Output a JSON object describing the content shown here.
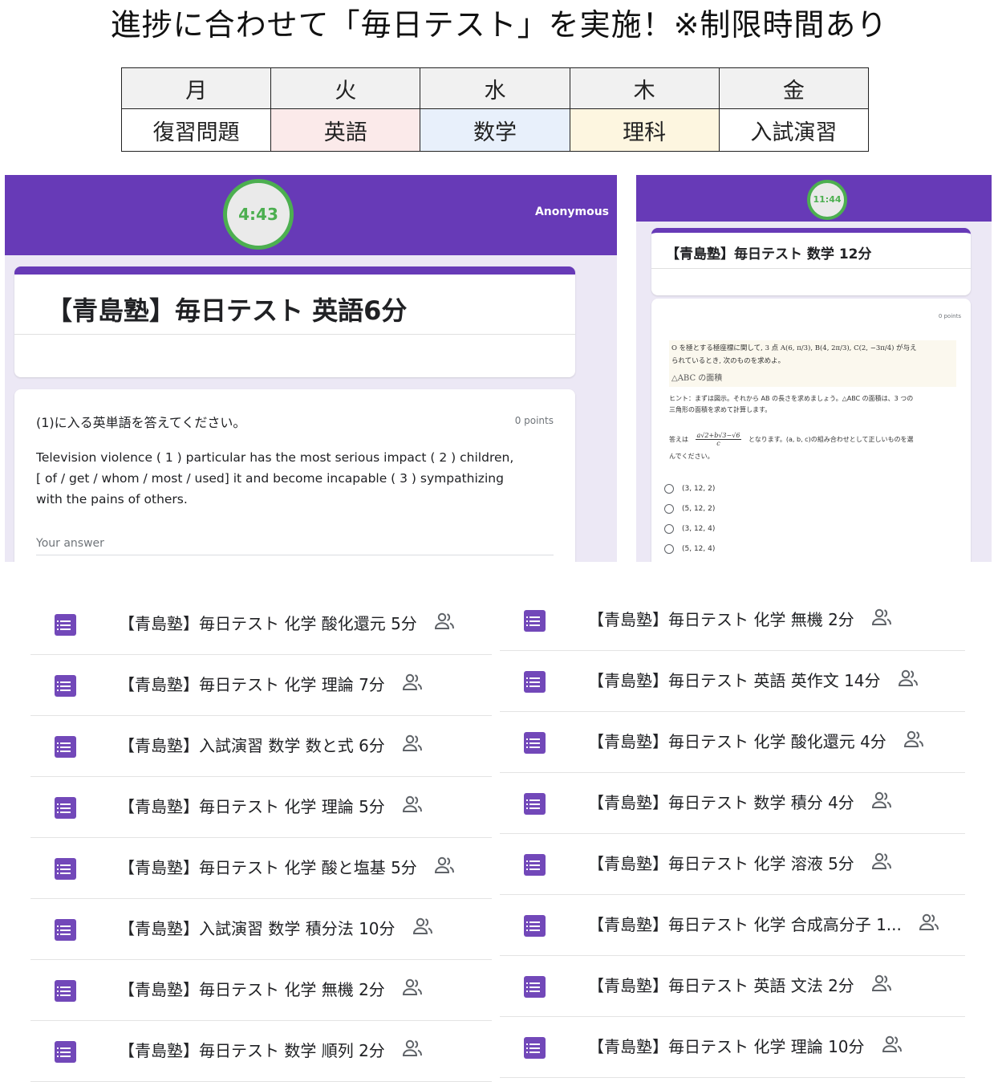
{
  "headline": "進捗に合わせて「毎日テスト」を実施！※制限時間あり",
  "schedule": {
    "days": [
      "月",
      "火",
      "水",
      "木",
      "金"
    ],
    "subjects": [
      "復習問題",
      "英語",
      "数学",
      "理科",
      "入試演習"
    ],
    "cell_colors": [
      "#ffffff",
      "#fbeaea",
      "#e8f0fb",
      "#fdf6e0",
      "#ffffff"
    ]
  },
  "form_english": {
    "timer": "4:43",
    "user": "Anonymous",
    "title": "【青島塾】毎日テスト 英語6分",
    "question": "(1)に入る英単語を答えてください。",
    "points": "0 points",
    "passage_lines": [
      "Television violence ( 1 ) particular has the most serious impact ( 2 ) children,",
      "[ of / get / whom / most / used] it and become incapable ( 3 ) sympathizing",
      "with the pains of others."
    ],
    "answer_placeholder": "Your answer"
  },
  "form_math": {
    "timer": "11:44",
    "title": "【青島塾】毎日テスト 数学 12分",
    "points": "0 points",
    "problem_lines": [
      "O を極とする極座標に関して, 3 点 A(6, π/3), B(4, 2π/3), C(2, −3π/4) が与え",
      "られているとき, 次のものを求めよ。"
    ],
    "sub_question": "△ABC の面積",
    "hint_lines": [
      "ヒント：まずは図示。それから AB の長さを求めましょう。△ABC の面積は、3 つの",
      "三角形の面積を求めて計算します。"
    ],
    "answer_prefix": "答えは",
    "formula_numerator": "a√2+b√3−√6",
    "formula_denominator": "c",
    "answer_suffix": "となります。(a, b, c)の組み合わせとして正しいものを選",
    "answer_suffix2": "んでください。",
    "options": [
      "(3, 12, 2)",
      "(5, 12, 2)",
      "(3, 12, 4)",
      "(5, 12, 4)"
    ]
  },
  "list_left": [
    "【青島塾】毎日テスト 化学 酸化還元 5分",
    "【青島塾】毎日テスト 化学 理論 7分",
    "【青島塾】入試演習 数学 数と式 6分",
    "【青島塾】毎日テスト 化学 理論 5分",
    "【青島塾】毎日テスト 化学 酸と塩基 5分",
    "【青島塾】入試演習 数学 積分法 10分",
    "【青島塾】毎日テスト 化学 無機 2分",
    "【青島塾】毎日テスト 数学 順列 2分"
  ],
  "list_right": [
    "【青島塾】毎日テスト 化学 無機 2分",
    "【青島塾】毎日テスト 英語 英作文 14分",
    "【青島塾】毎日テスト 化学 酸化還元 4分",
    "【青島塾】毎日テスト 数学 積分 4分",
    "【青島塾】毎日テスト 化学 溶液 5分",
    "【青島塾】毎日テスト 化学 合成高分子 1...",
    "【青島塾】毎日テスト 英語 文法 2分",
    "【青島塾】毎日テスト 化学 理論 10分"
  ],
  "icons": {
    "form": "forms-icon",
    "shared": "people-icon"
  },
  "colors": {
    "form_purple": "#673ab7",
    "timer_green": "#4caf50",
    "icon_purple": "#7248b9"
  }
}
